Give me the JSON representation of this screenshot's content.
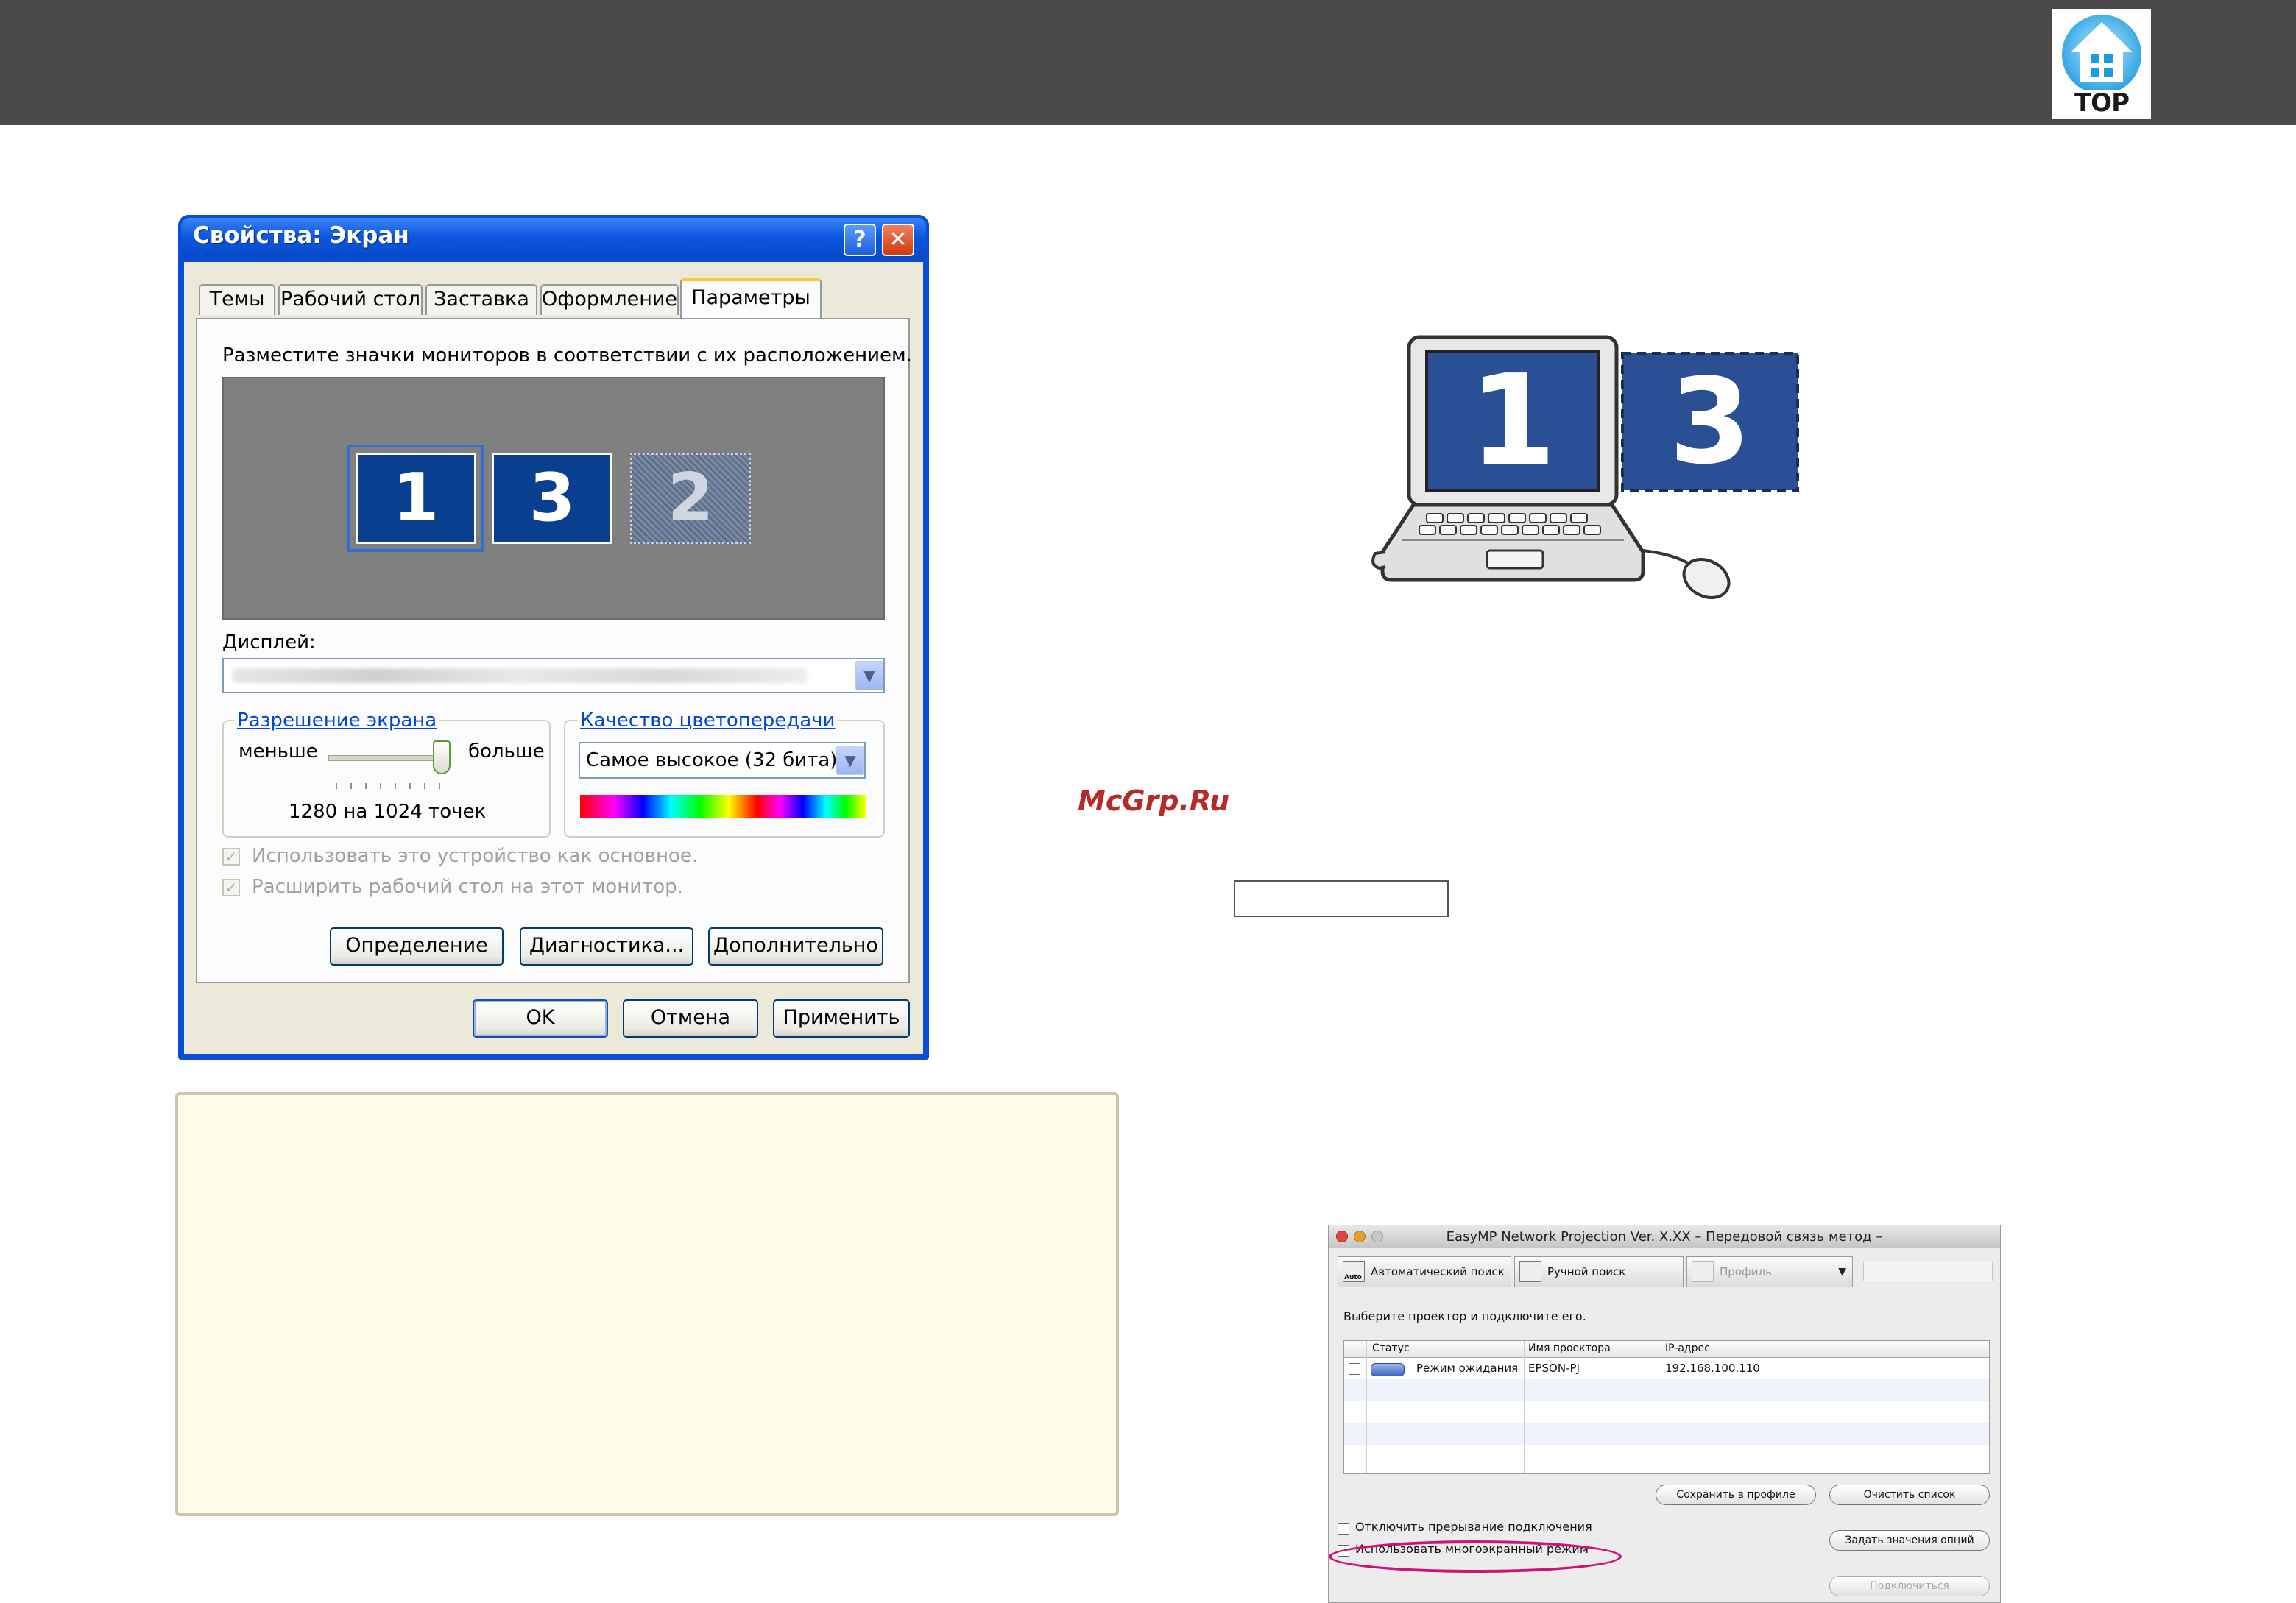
{
  "header": {
    "logo_text": "TOP"
  },
  "dialog": {
    "title": "Свойства: Экран",
    "help_glyph": "?",
    "close_glyph": "✕",
    "tabs": [
      "Темы",
      "Рабочий стол",
      "Заставка",
      "Оформление",
      "Параметры"
    ],
    "instruction": "Разместите значки мониторов в соответствии с их расположением.",
    "monitors": [
      "1",
      "3",
      "2"
    ],
    "display_label": "Дисплей:",
    "resolution_group": "Разрешение экрана",
    "less_label": "меньше",
    "more_label": "больше",
    "resolution_value": "1280 на 1024 точек",
    "color_group": "Качество цветопередачи",
    "color_value": "Самое высокое (32 бита)",
    "check_primary": "Использовать это устройство как основное.",
    "check_extend": "Расширить рабочий стол на этот монитор.",
    "btn_identify": "Определение",
    "btn_troubleshoot": "Диагностика...",
    "btn_advanced": "Дополнительно",
    "btn_ok": "OK",
    "btn_cancel": "Отмена",
    "btn_apply": "Применить"
  },
  "watermark": "McGrp.Ru",
  "illustration": {
    "monitor_left": "1",
    "monitor_right": "3"
  },
  "mac_window": {
    "title": "EasyMP Network Projection Ver. X.XX – Передовой связь метод –",
    "toolbar": {
      "auto_search": "Автоматический поиск",
      "manual_search": "Ручной поиск",
      "profile": "Профиль",
      "auto_icon_text": "Auto"
    },
    "instruction": "Выберите проектор и подключите его.",
    "columns": {
      "status": "Статус",
      "name": "Имя проектора",
      "ip": "IP-адрес"
    },
    "row": {
      "status": "Режим ожидания",
      "name": "EPSON-PJ",
      "ip": "192.168.100.110"
    },
    "btn_save_profile": "Сохранить в профиле",
    "btn_clear_list": "Очистить список",
    "btn_set_options": "Задать значения опций",
    "btn_connect": "Подключиться",
    "check_disable_interrupt": "Отключить прерывание подключения",
    "check_multiscreen": "Использовать многоэкранный режим"
  }
}
